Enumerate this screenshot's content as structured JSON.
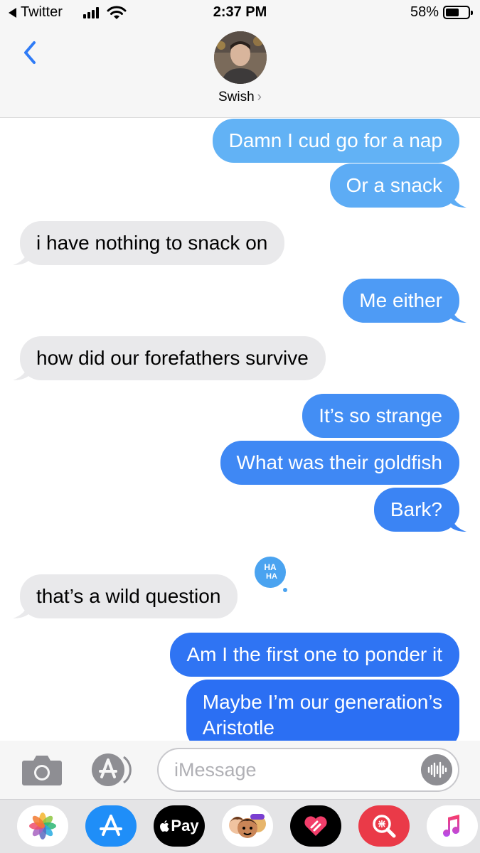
{
  "status_bar": {
    "back_app": "Twitter",
    "time": "2:37 PM",
    "battery_percent": "58%",
    "battery_level": 0.58
  },
  "header": {
    "contact_name": "Swish",
    "contact_chevron": "›"
  },
  "messages": [
    {
      "direction": "out",
      "text": "Damn I cud go for a nap",
      "color": "#62b2f5"
    },
    {
      "direction": "out",
      "text": "Or a snack",
      "color": "#5dacf5"
    },
    {
      "direction": "in",
      "text": "i have nothing to snack on"
    },
    {
      "direction": "out",
      "text": "Me either",
      "color": "#4e9bf5"
    },
    {
      "direction": "in",
      "text": "how did our forefathers survive"
    },
    {
      "direction": "out",
      "text": "It’s so strange",
      "color": "#438ef4"
    },
    {
      "direction": "out",
      "text": "What was their goldfish",
      "color": "#3f88f4"
    },
    {
      "direction": "out",
      "text": "Bark?",
      "color": "#3b84f4"
    },
    {
      "direction": "in",
      "text": "that’s a wild question",
      "tapback": {
        "icon": "haha-tapback-icon",
        "text": "HA HA"
      }
    },
    {
      "direction": "out",
      "text": "Am I the first one to ponder it",
      "color": "#2f74f3"
    },
    {
      "direction": "out",
      "text": "Maybe I’m our generation’s\nAristotle",
      "color": "#2b6ff3"
    }
  ],
  "input_bar": {
    "placeholder": "iMessage",
    "icons": [
      "camera-icon",
      "app-store-icon",
      "audio-waveform-icon"
    ]
  },
  "app_drawer": {
    "apps": [
      {
        "name": "photos",
        "icon": "photos-icon"
      },
      {
        "name": "app-store",
        "icon": "app-store-icon"
      },
      {
        "name": "apple-pay",
        "icon": "apple-pay-icon",
        "label": "Pay"
      },
      {
        "name": "memoji",
        "icon": "memoji-icon"
      },
      {
        "name": "digital-touch",
        "icon": "digital-touch-icon"
      },
      {
        "name": "image-search",
        "icon": "image-search-icon"
      },
      {
        "name": "music",
        "icon": "music-icon"
      }
    ]
  },
  "colors": {
    "bar_bg": "#f6f6f6",
    "incoming_bubble": "#e9e9eb",
    "ios_blue": "#2f7bf6",
    "tapback_blue": "#4aa3f0"
  }
}
